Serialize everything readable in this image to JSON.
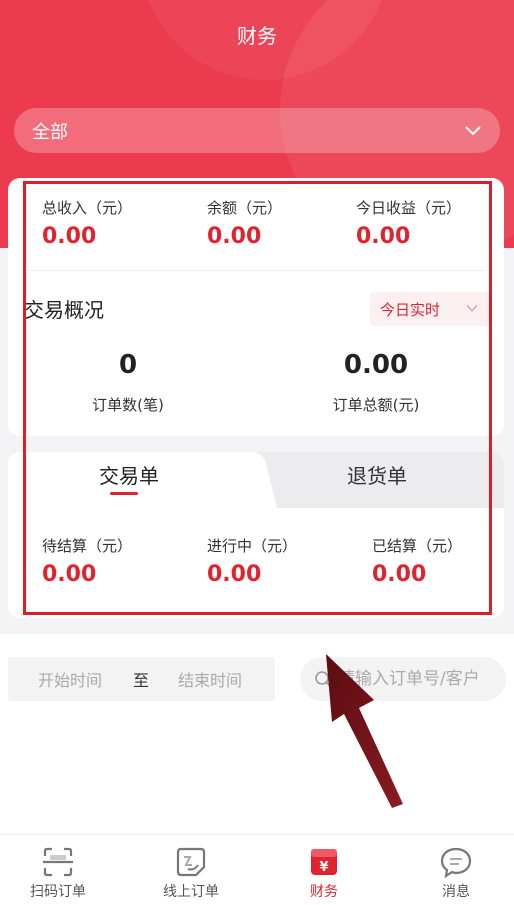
{
  "header": {
    "title": "财务"
  },
  "store_select": {
    "value": "全部"
  },
  "summary": [
    {
      "label": "总收入（元）",
      "value": "0.00"
    },
    {
      "label": "余额（元）",
      "value": "0.00"
    },
    {
      "label": "今日收益（元）",
      "value": "0.00"
    }
  ],
  "overview": {
    "title": "交易概况",
    "period": "今日实时",
    "stats": [
      {
        "value": "0",
        "label": "订单数(笔)"
      },
      {
        "value": "0.00",
        "label": "订单总额(元)"
      }
    ]
  },
  "tabs": [
    {
      "label": "交易单",
      "active": true
    },
    {
      "label": "退货单",
      "active": false
    }
  ],
  "settlement": [
    {
      "label": "待结算（元）",
      "value": "0.00"
    },
    {
      "label": "进行中（元）",
      "value": "0.00"
    },
    {
      "label": "已结算（元）",
      "value": "0.00"
    }
  ],
  "filter": {
    "start_placeholder": "开始时间",
    "separator": "至",
    "end_placeholder": "结束时间",
    "search_placeholder": "请输入订单号/客户"
  },
  "tabbar": [
    {
      "label": "扫码订单",
      "icon": "scan-icon",
      "active": false
    },
    {
      "label": "线上订单",
      "icon": "order-icon",
      "active": false
    },
    {
      "label": "财务",
      "icon": "wallet-icon",
      "active": true
    },
    {
      "label": "消息",
      "icon": "message-icon",
      "active": false
    }
  ],
  "colors": {
    "brand": "#ec3a4e",
    "value_red": "#e0242f",
    "highlight": "#d9202a"
  }
}
